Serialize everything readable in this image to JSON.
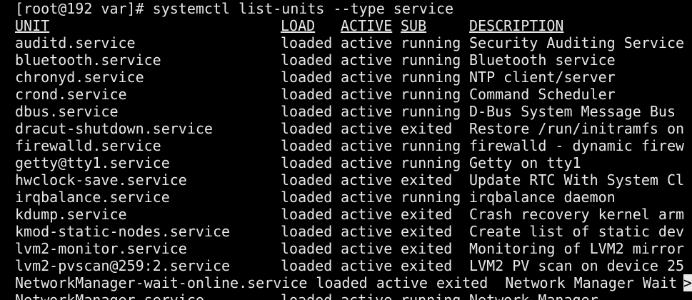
{
  "terminal": {
    "prompt": "[root@192 var]# systemctl list-units --type service",
    "header": {
      "unit": "UNIT",
      "load": "LOAD",
      "active": "ACTIVE",
      "sub": "SUB",
      "description": "DESCRIPTION"
    },
    "rows": [
      {
        "unit": "auditd.service",
        "load": "loaded",
        "active": "active",
        "sub": "running",
        "description": "Security Auditing Service"
      },
      {
        "unit": "bluetooth.service",
        "load": "loaded",
        "active": "active",
        "sub": "running",
        "description": "Bluetooth service"
      },
      {
        "unit": "chronyd.service",
        "load": "loaded",
        "active": "active",
        "sub": "running",
        "description": "NTP client/server"
      },
      {
        "unit": "crond.service",
        "load": "loaded",
        "active": "active",
        "sub": "running",
        "description": "Command Scheduler"
      },
      {
        "unit": "dbus.service",
        "load": "loaded",
        "active": "active",
        "sub": "running",
        "description": "D-Bus System Message Bus"
      },
      {
        "unit": "dracut-shutdown.service",
        "load": "loaded",
        "active": "active",
        "sub": "exited",
        "description": "Restore /run/initramfs on"
      },
      {
        "unit": "firewalld.service",
        "load": "loaded",
        "active": "active",
        "sub": "running",
        "description": "firewalld - dynamic firew"
      },
      {
        "unit": "getty@tty1.service",
        "load": "loaded",
        "active": "active",
        "sub": "running",
        "description": "Getty on tty1"
      },
      {
        "unit": "hwclock-save.service",
        "load": "loaded",
        "active": "active",
        "sub": "exited",
        "description": "Update RTC With System Cl"
      },
      {
        "unit": "irqbalance.service",
        "load": "loaded",
        "active": "active",
        "sub": "running",
        "description": "irqbalance daemon"
      },
      {
        "unit": "kdump.service",
        "load": "loaded",
        "active": "active",
        "sub": "exited",
        "description": "Crash recovery kernel arm"
      },
      {
        "unit": "kmod-static-nodes.service",
        "load": "loaded",
        "active": "active",
        "sub": "exited",
        "description": "Create list of static dev"
      },
      {
        "unit": "lvm2-monitor.service",
        "load": "loaded",
        "active": "active",
        "sub": "exited",
        "description": "Monitoring of LVM2 mirror"
      },
      {
        "unit": "lvm2-pvscan@259:2.service",
        "load": "loaded",
        "active": "active",
        "sub": "exited",
        "description": "LVM2 PV scan on device 25"
      }
    ],
    "wrap_line": "NetworkManager-wait-online.service loaded active exited  Network Manager Wait",
    "overflow_marker": ">",
    "last_row": {
      "unit": "NetworkManager.service",
      "load": "loaded",
      "active": "active",
      "sub": "running",
      "description": "Network Manager"
    }
  }
}
